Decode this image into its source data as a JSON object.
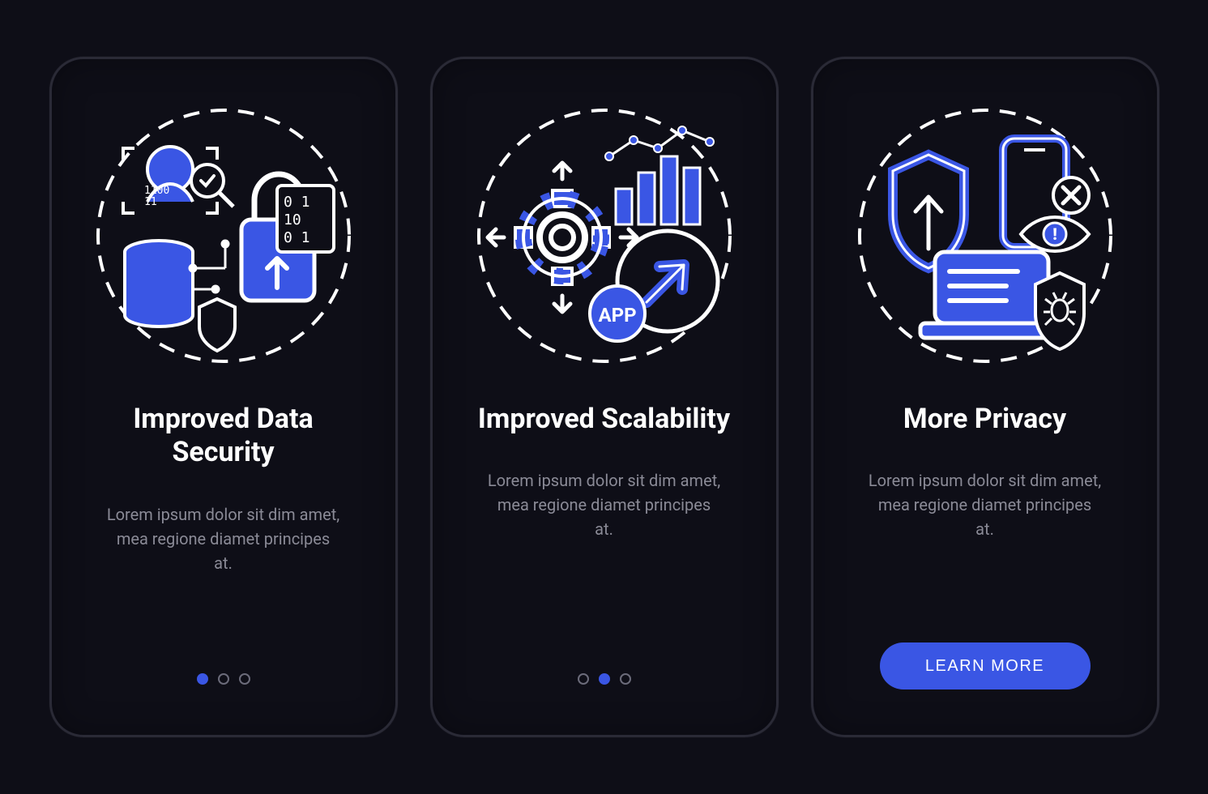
{
  "colors": {
    "accent": "#3a56e4",
    "stroke": "#ffffff",
    "bg": "#0e0e17"
  },
  "cards": [
    {
      "icon": "security-icon",
      "title": "Improved Data Security",
      "body": "Lorem ipsum dolor sit dim amet, mea regione diamet principes at.",
      "pager": {
        "count": 3,
        "active": 0
      }
    },
    {
      "icon": "scalability-icon",
      "title": "Improved Scalability",
      "body": "Lorem ipsum dolor sit dim amet, mea regione diamet principes at.",
      "pager": {
        "count": 3,
        "active": 1
      },
      "app_badge": "APP"
    },
    {
      "icon": "privacy-icon",
      "title": "More Privacy",
      "body": "Lorem ipsum dolor sit dim amet, mea regione diamet principes at.",
      "cta": "LEARN MORE"
    }
  ]
}
